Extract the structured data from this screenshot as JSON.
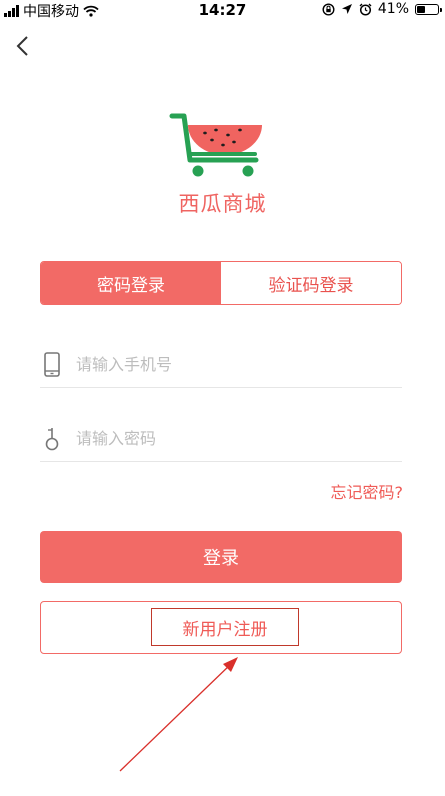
{
  "status_bar": {
    "carrier": "中国移动",
    "time": "14:27",
    "battery": "41%",
    "battery_level": 0.41,
    "icons": [
      "signal-icon",
      "wifi-icon",
      "screen-lock-icon",
      "location-icon",
      "alarm-icon",
      "battery-icon"
    ]
  },
  "nav": {
    "back_icon": "chevron-left-icon"
  },
  "brand": {
    "name": "西瓜商城",
    "logo_icon": "watermelon-cart-icon",
    "accent_color": "#f26a66",
    "watermelon_flesh": "#f06460",
    "cart_color": "#27a153"
  },
  "tabs": [
    {
      "label": "密码登录",
      "active": true
    },
    {
      "label": "验证码登录",
      "active": false
    }
  ],
  "form": {
    "phone": {
      "placeholder": "请输入手机号",
      "value": "",
      "icon": "phone-icon"
    },
    "password": {
      "placeholder": "请输入密码",
      "value": "",
      "icon": "key-icon"
    }
  },
  "links": {
    "forgot_password": "忘记密码?"
  },
  "buttons": {
    "login": "登录",
    "register": "新用户注册"
  },
  "annotation": {
    "highlight_color": "#c0392b",
    "arrow_color": "#d9302b"
  }
}
